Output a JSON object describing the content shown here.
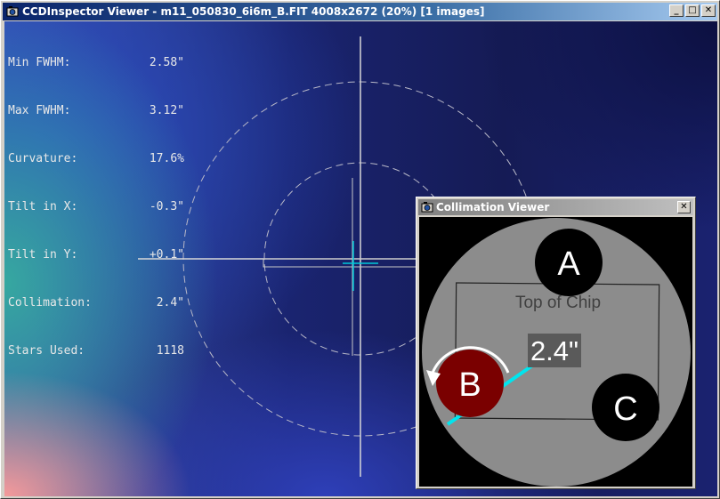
{
  "window": {
    "title": "CCDInspector Viewer - m11_050830_6i6m_B.FIT 4008x2672 (20%)  [1 images]",
    "minimize_glyph": "_",
    "maximize_glyph": "□",
    "close_glyph": "✕"
  },
  "stats": [
    {
      "label": "Min FWHM:",
      "value": "2.58\""
    },
    {
      "label": "Max FWHM:",
      "value": "3.12\""
    },
    {
      "label": "Curvature:",
      "value": "17.6%"
    },
    {
      "label": "Tilt in X:",
      "value": "-0.3\""
    },
    {
      "label": "Tilt in Y:",
      "value": "+0.1\""
    },
    {
      "label": "Collimation:",
      "value": "2.4\""
    },
    {
      "label": "Stars Used:",
      "value": "1118"
    }
  ],
  "collimation_viewer": {
    "title": "Collimation Viewer",
    "close_glyph": "✕",
    "chip_label": "Top of Chip",
    "collimation_value": "2.4\"",
    "marker_a": "A",
    "marker_b": "B",
    "marker_c": "C"
  },
  "colors": {
    "title_active": "#0a246a",
    "title_inactive": "#808080",
    "marker_b": "#7a0000",
    "collimation_line": "#00e5ee",
    "viewer_disc": "#8c8c8c"
  }
}
